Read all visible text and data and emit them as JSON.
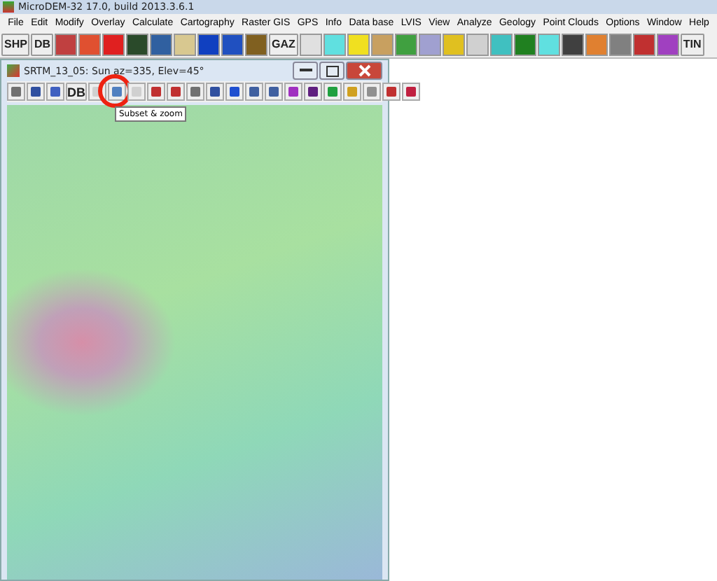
{
  "window": {
    "title": "MicroDEM-32 17.0, build 2013.3.6.1"
  },
  "menu": [
    "File",
    "Edit",
    "Modify",
    "Overlay",
    "Calculate",
    "Cartography",
    "Raster GIS",
    "GPS",
    "Info",
    "Data base",
    "LVIS",
    "View",
    "Analyze",
    "Geology",
    "Point Clouds",
    "Options",
    "Window",
    "Help"
  ],
  "toolbar": [
    {
      "kind": "text",
      "label": "SHP"
    },
    {
      "kind": "text",
      "label": "DB"
    },
    {
      "kind": "icon",
      "color": "#c04040"
    },
    {
      "kind": "icon",
      "color": "#e05030"
    },
    {
      "kind": "icon",
      "color": "#e02020"
    },
    {
      "kind": "icon",
      "color": "#2a4a2a"
    },
    {
      "kind": "icon",
      "color": "#3060a0"
    },
    {
      "kind": "icon",
      "color": "#d8c890"
    },
    {
      "kind": "icon",
      "color": "#1040c0"
    },
    {
      "kind": "icon",
      "color": "#2050c0"
    },
    {
      "kind": "icon",
      "color": "#806020"
    },
    {
      "kind": "text",
      "label": "GAZ"
    },
    {
      "kind": "icon",
      "color": "#e0e0e0"
    },
    {
      "kind": "icon",
      "color": "#60e0e0"
    },
    {
      "kind": "icon",
      "color": "#f0e020"
    },
    {
      "kind": "icon",
      "color": "#c8a060"
    },
    {
      "kind": "icon",
      "color": "#40a040"
    },
    {
      "kind": "icon",
      "color": "#a0a0d0"
    },
    {
      "kind": "icon",
      "color": "#e0c020"
    },
    {
      "kind": "icon",
      "color": "#d0d0d0"
    },
    {
      "kind": "icon",
      "color": "#40c0c0"
    },
    {
      "kind": "icon",
      "color": "#208020"
    },
    {
      "kind": "icon",
      "color": "#60e0e0"
    },
    {
      "kind": "icon",
      "color": "#404040"
    },
    {
      "kind": "icon",
      "color": "#e08030"
    },
    {
      "kind": "icon",
      "color": "#808080"
    },
    {
      "kind": "icon",
      "color": "#c03030"
    },
    {
      "kind": "icon",
      "color": "#a040c0"
    },
    {
      "kind": "text",
      "label": "TIN"
    }
  ],
  "child": {
    "title": "SRTM_13_05: Sun az=335, Elev=45°",
    "toolbar": [
      {
        "kind": "icon",
        "color": "#707070",
        "highlighted": false
      },
      {
        "kind": "icon",
        "color": "#3050a0",
        "highlighted": false
      },
      {
        "kind": "icon",
        "color": "#4060c0",
        "highlighted": false
      },
      {
        "kind": "text",
        "label": "DB",
        "highlighted": false
      },
      {
        "kind": "icon",
        "color": "#d0d0d0",
        "highlighted": false
      },
      {
        "kind": "icon",
        "color": "#5080c0",
        "highlighted": true
      },
      {
        "kind": "icon",
        "color": "#d0d0d0",
        "highlighted": false
      },
      {
        "kind": "icon",
        "color": "#c03030",
        "highlighted": false
      },
      {
        "kind": "icon",
        "color": "#c03030",
        "highlighted": false
      },
      {
        "kind": "icon",
        "color": "#707070",
        "highlighted": false
      },
      {
        "kind": "icon",
        "color": "#3050a0",
        "highlighted": false
      },
      {
        "kind": "icon",
        "color": "#2050d0",
        "highlighted": false
      },
      {
        "kind": "icon",
        "color": "#4060a0",
        "highlighted": false
      },
      {
        "kind": "icon",
        "color": "#4060a0",
        "highlighted": false
      },
      {
        "kind": "icon",
        "color": "#a030c0",
        "highlighted": false
      },
      {
        "kind": "icon",
        "color": "#602080",
        "highlighted": false
      },
      {
        "kind": "icon",
        "color": "#20a040",
        "highlighted": false
      },
      {
        "kind": "icon",
        "color": "#d0a020",
        "highlighted": false
      },
      {
        "kind": "icon",
        "color": "#909090",
        "highlighted": false
      },
      {
        "kind": "icon",
        "color": "#c03030",
        "highlighted": false
      },
      {
        "kind": "icon",
        "color": "#c02040",
        "highlighted": false
      }
    ],
    "tooltip": "Subset & zoom"
  }
}
